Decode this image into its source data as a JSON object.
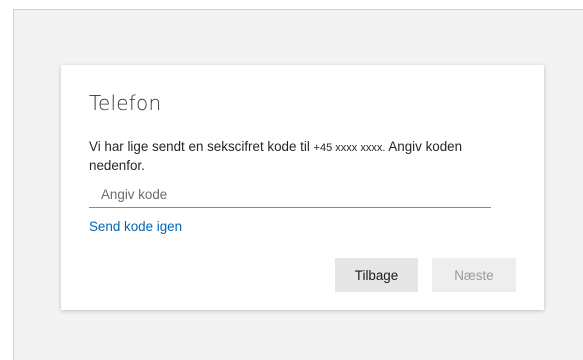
{
  "dialog": {
    "title": "Telefon",
    "message_prefix": "Vi har lige sendt en sekscifret kode til ",
    "masked_number": "+45 xxxx xxxx.",
    "message_suffix": "  Angiv koden nedenfor.",
    "code_input": {
      "placeholder": "Angiv kode",
      "value": ""
    },
    "resend_link": "Send kode igen",
    "back_button": "Tilbage",
    "next_button": "Næste",
    "colors": {
      "link": "#0067b8",
      "background": "#f3f3f3",
      "card": "#ffffff"
    }
  }
}
